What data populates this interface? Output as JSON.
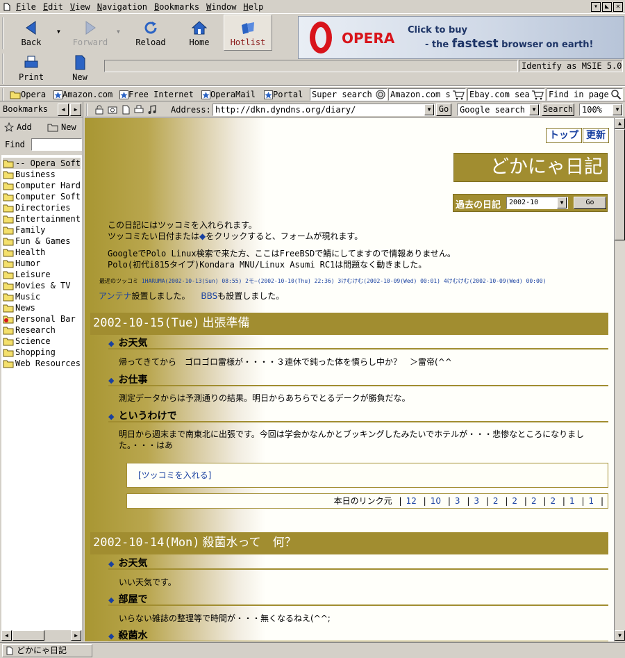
{
  "menu": [
    "File",
    "Edit",
    "View",
    "Navigation",
    "Bookmarks",
    "Window",
    "Help"
  ],
  "toolbar": {
    "back": "Back",
    "forward": "Forward",
    "reload": "Reload",
    "home": "Home",
    "hotlist": "Hotlist",
    "print": "Print",
    "new": "New",
    "identify": "Identify as MSIE 5.0"
  },
  "banner": {
    "brand": "OPERA",
    "line1": "Click to buy",
    "line2_pre": "- the",
    "line2_em": "fastest",
    "line2_post": "browser on earth!"
  },
  "personal_bar": {
    "links": [
      "Opera",
      "Amazon.com",
      "Free Internet",
      "OperaMail",
      "Portal"
    ],
    "fields": [
      "Super search",
      "Amazon.com s",
      "Ebay.com sea",
      "Find in page"
    ]
  },
  "panel": {
    "title": "Bookmarks",
    "add": "Add",
    "new": "New",
    "find_label": "Find",
    "find_value": "",
    "folders": [
      "-- Opera Software",
      "Business",
      "Computer Hardware",
      "Computer Software",
      "Directories",
      "Entertainment",
      "Family",
      "Fun & Games",
      "Health",
      "Humor",
      "Leisure",
      "Movies & TV",
      "Music",
      "News",
      "Personal Bar",
      "Research",
      "Science",
      "Shopping",
      "Web Resources"
    ]
  },
  "address": {
    "label": "Address:",
    "url": "http://dkn.dyndns.org/diary/",
    "go": "Go",
    "search_engine": "Google search",
    "search_btn": "Search",
    "zoom": "100%"
  },
  "page": {
    "nav_top": "トップ",
    "nav_update": "更新",
    "site_title": "どかにゃ日記",
    "past_label": "過去の日記",
    "past_value": "2002-10",
    "past_go": "Go",
    "intro1": "この日記にはツッコミを入れられます。",
    "intro2_pre": "ツッコミたい日付または",
    "intro2_mark": "◆",
    "intro2_post": "をクリックすると、フォームが現れます。",
    "notice1": "GoogleでPolo Linux検索で来た方、ここはFreeBSDで鯖にしてますので情報ありません。",
    "notice2": "Polo(初代i815タイプ)Kondara MNU/Linux Asumi RC1は問題なく動きました。",
    "recent_label": "最近のツッコミ",
    "recent": [
      "1HARUMA(2002-10-13(Sun) 08:55)",
      "2モ~(2002-10-10(Thu) 22:36)",
      "3けむけむ(2002-10-09(Wed) 00:01)",
      "4けむけむ(2002-10-09(Wed) 00:00)"
    ],
    "antenna_link": "アンテナ",
    "antenna_text": "設置しました。",
    "bbs_link": "BBS",
    "bbs_text": "も設置しました。",
    "days": [
      {
        "date": "2002-10-15(Tue)",
        "title": "出張準備",
        "sections": [
          {
            "head": "お天気",
            "body": "帰ってきてから　ゴロゴロ雷様が・・・・３連休で鈍った体を慣らし中か？　＞雷帝(^^"
          },
          {
            "head": "お仕事",
            "body": "測定データからは予測通りの結果。明日からあちらでとるデークが勝負だな。"
          },
          {
            "head": "というわけで",
            "body": "明日から週末まで南東北に出張です。今回は学会かなんかとブッキングしたみたいでホテルが・・・悲惨なところになりました。・・・はあ"
          }
        ],
        "tsukkomi": "[ツッコミを入れる]",
        "links_label": "本日のリンク元",
        "links": [
          "12",
          "10",
          "3",
          "3",
          "2",
          "2",
          "2",
          "2",
          "1",
          "1"
        ]
      },
      {
        "date": "2002-10-14(Mon)",
        "title": "殺菌水って　何？",
        "sections": [
          {
            "head": "お天気",
            "body": "いい天気です。"
          },
          {
            "head": "部屋で",
            "body": "いらない雑誌の整理等で時間が・・・無くなるねえ(^^;"
          },
          {
            "head": "殺菌水",
            "body": ""
          }
        ]
      }
    ]
  },
  "status": {
    "tab": "どかにゃ日記"
  }
}
